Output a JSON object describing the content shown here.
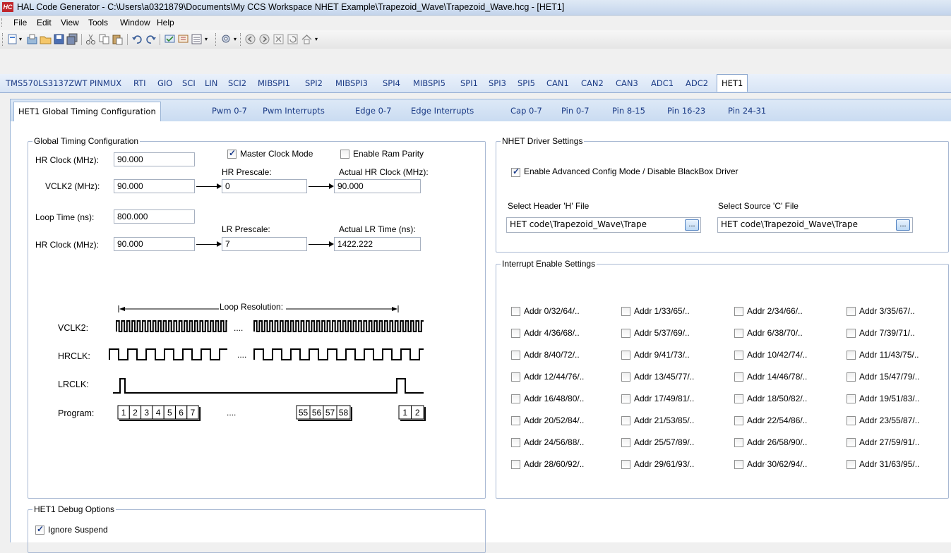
{
  "window": {
    "title": "HAL Code Generator - C:\\Users\\a0321879\\Documents\\My CCS Workspace NHET Example\\Trapezoid_Wave\\Trapezoid_Wave.hcg - [HET1]",
    "app_icon_text": "HC"
  },
  "menu": [
    "File",
    "Edit",
    "View",
    "Tools",
    "Window",
    "Help"
  ],
  "peripheral_tabs": [
    "TMS570LS3137ZWT",
    "PINMUX",
    "RTI",
    "GIO",
    "SCI",
    "LIN",
    "SCI2",
    "MIBSPI1",
    "SPI2",
    "MIBSPI3",
    "SPI4",
    "MIBSPI5",
    "SPI1",
    "SPI3",
    "SPI5",
    "CAN1",
    "CAN2",
    "CAN3",
    "ADC1",
    "ADC2",
    "HET1"
  ],
  "sub_tabs": [
    "HET1 Global Timing Configuration",
    "Pwm 0-7",
    "Pwm Interrupts",
    "Edge 0-7",
    "Edge Interrupts",
    "Cap 0-7",
    "Pin 0-7",
    "Pin 8-15",
    "Pin 16-23",
    "Pin 24-31"
  ],
  "global_timing": {
    "title": "Global Timing Configuration",
    "hr_clock_label": "HR Clock (MHz):",
    "hr_clock_value": "90.000",
    "master_clock_label": "Master Clock Mode",
    "master_clock_checked": true,
    "ram_parity_label": "Enable Ram Parity",
    "ram_parity_checked": false,
    "hr_prescale_label": "HR Prescale:",
    "hr_prescale_value": "0",
    "actual_hr_label": "Actual HR Clock (MHz):",
    "actual_hr_value": "90.000",
    "vclk2_label": "VCLK2 (MHz):",
    "vclk2_value": "90.000",
    "loop_time_label": "Loop Time (ns):",
    "loop_time_value": "800.000",
    "lr_prescale_label": "LR Prescale:",
    "lr_prescale_value": "7",
    "actual_lr_label": "Actual LR Time (ns):",
    "actual_lr_value": "1422.222",
    "hr_clock2_label": "HR Clock (MHz):",
    "hr_clock2_value": "90.000"
  },
  "timing_diagram": {
    "loop_resolution": "Loop Resolution:",
    "vclk2": "VCLK2:",
    "hrclk": "HRCLK:",
    "lrclk": "LRCLK:",
    "program": "Program:",
    "ellipsis": "....",
    "program_cells_a": [
      "1",
      "2",
      "3",
      "4",
      "5",
      "6",
      "7"
    ],
    "program_cells_b": [
      "55",
      "56",
      "57",
      "58"
    ],
    "program_cells_c": [
      "1",
      "2"
    ]
  },
  "debug": {
    "title": "HET1 Debug Options",
    "ignore_suspend_label": "Ignore Suspend",
    "ignore_suspend_checked": true
  },
  "driver": {
    "title": "NHET Driver Settings",
    "advanced_label": "Enable Advanced Config Mode / Disable BlackBox Driver",
    "advanced_checked": true,
    "header_label": "Select Header 'H' File",
    "header_value": "HET code\\Trapezoid_Wave\\Trape",
    "source_label": "Select Source 'C' File",
    "source_value": "HET code\\Trapezoid_Wave\\Trape",
    "browse_label": "..."
  },
  "interrupts": {
    "title": "Interrupt Enable Settings",
    "items": [
      "Addr 0/32/64/..",
      "Addr 1/33/65/..",
      "Addr 2/34/66/..",
      "Addr 3/35/67/..",
      "Addr 4/36/68/..",
      "Addr 5/37/69/..",
      "Addr 6/38/70/..",
      "Addr 7/39/71/..",
      "Addr 8/40/72/..",
      "Addr 9/41/73/..",
      "Addr 10/42/74/..",
      "Addr 11/43/75/..",
      "Addr 12/44/76/..",
      "Addr 13/45/77/..",
      "Addr 14/46/78/..",
      "Addr 15/47/79/..",
      "Addr 16/48/80/..",
      "Addr 17/49/81/..",
      "Addr 18/50/82/..",
      "Addr 19/51/83/..",
      "Addr 20/52/84/..",
      "Addr 21/53/85/..",
      "Addr 22/54/86/..",
      "Addr 23/55/87/..",
      "Addr 24/56/88/..",
      "Addr 25/57/89/..",
      "Addr 26/58/90/..",
      "Addr 27/59/91/..",
      "Addr 28/60/92/..",
      "Addr 29/61/93/..",
      "Addr 30/62/94/..",
      "Addr 31/63/95/.."
    ]
  },
  "toolbar_icons": [
    "new-icon",
    "open-icon",
    "folder-icon",
    "save-icon",
    "save-all-icon",
    "cut-icon",
    "copy-icon",
    "paste-icon",
    "undo-icon",
    "redo-icon",
    "generate-icon",
    "build-icon",
    "list-icon",
    "settings-icon",
    "back-icon",
    "forward-icon",
    "close-doc-icon",
    "refresh-icon",
    "home-icon"
  ]
}
